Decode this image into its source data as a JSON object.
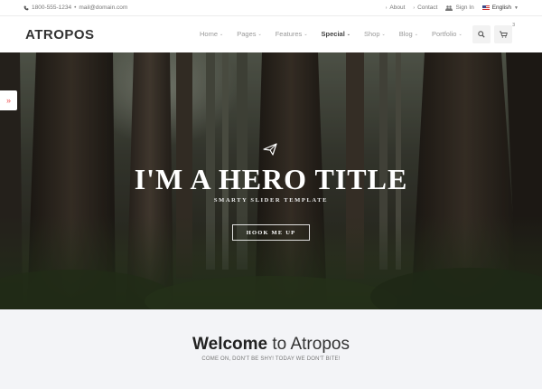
{
  "topbar": {
    "phone": "1800-555-1234",
    "separator": "•",
    "email": "mail@domain.com",
    "about": "About",
    "contact": "Contact",
    "signin": "Sign In",
    "language": "English"
  },
  "header": {
    "logo": "ATROPOS",
    "nav": [
      "Home",
      "Pages",
      "Features",
      "Special",
      "Shop",
      "Blog",
      "Portfolio"
    ],
    "active_nav": "Special",
    "cart_count": "3"
  },
  "hero": {
    "title": "I'M A HERO TITLE",
    "subtitle": "SMARTY SLIDER TEMPLATE",
    "button": "HOOK ME UP",
    "side_toggle": "»"
  },
  "welcome": {
    "title_bold": "Welcome",
    "title_rest": "to Atropos",
    "subtitle": "COME ON, DON'T BE SHY! TODAY WE DON'T BITE!"
  },
  "colors": {
    "accent": "#e55555",
    "text_dark": "#333333",
    "welcome_bg": "#f3f4f7"
  }
}
